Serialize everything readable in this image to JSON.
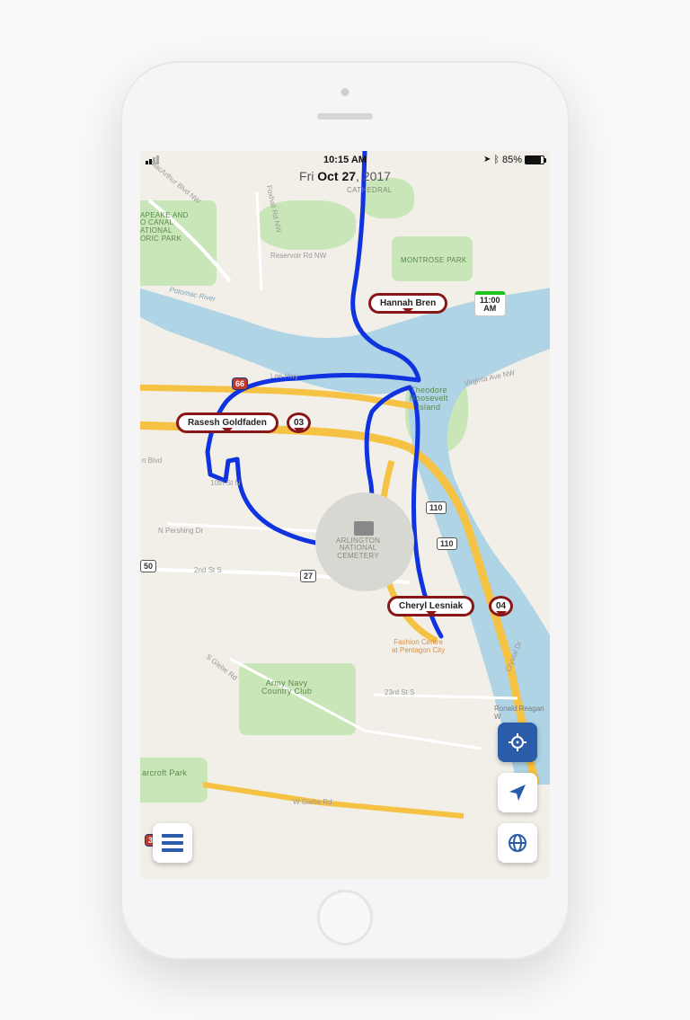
{
  "status": {
    "time": "10:15 AM",
    "battery_pct": "85%",
    "loc_icon": "▶",
    "bt_icon": "✱"
  },
  "date": {
    "prefix": "Fri ",
    "strong": "Oct 27",
    "suffix": ", 2017"
  },
  "pins": {
    "hannah": {
      "name": "Hannah Bren"
    },
    "time_badge": {
      "line1": "11:00",
      "line2": "AM"
    },
    "rasesh": {
      "name": "Rasesh Goldfaden"
    },
    "rasesh_num": "03",
    "cheryl": {
      "name": "Cheryl Lesniak"
    },
    "cheryl_num": "04"
  },
  "map_labels": {
    "chesapeake": "apeake and\no Canal\national\noric Park",
    "potomac": "Potomac River",
    "montrose": "Montrose Park",
    "cathedral": "CATHEDRAL",
    "roosevelt": "Theodore\nRoosevelt\nIsland",
    "arlington": "ARLINGTON\nNATIONAL\nCEMETERY",
    "pentagon": "Fashion Centre\nat Pentagon City",
    "armynavy": "Army Navy\nCountry Club",
    "barcroft": "arcroft Park",
    "reagan": "Ronald Reagan\nW",
    "lee": "Lee Hwy",
    "reservoir": "Reservoir Rd NW",
    "macarthur": "MacArthur Blvd NW",
    "foxhall": "Foxhall Rd NW",
    "virginia": "Virginia Ave NW",
    "tenth": "10th St N",
    "pershing": "N Pershing Dr",
    "second": "2nd St S",
    "glebe": "S Glebe Rd",
    "wglebe": "W Glebe Rd",
    "twentythird": "23rd St S",
    "crystal": "Crystal Dr",
    "nblvd": "n Blvd"
  },
  "shields": {
    "i66": "66",
    "r110a": "110",
    "r110b": "110",
    "r27": "27",
    "r50": "50",
    "i395": "395"
  }
}
